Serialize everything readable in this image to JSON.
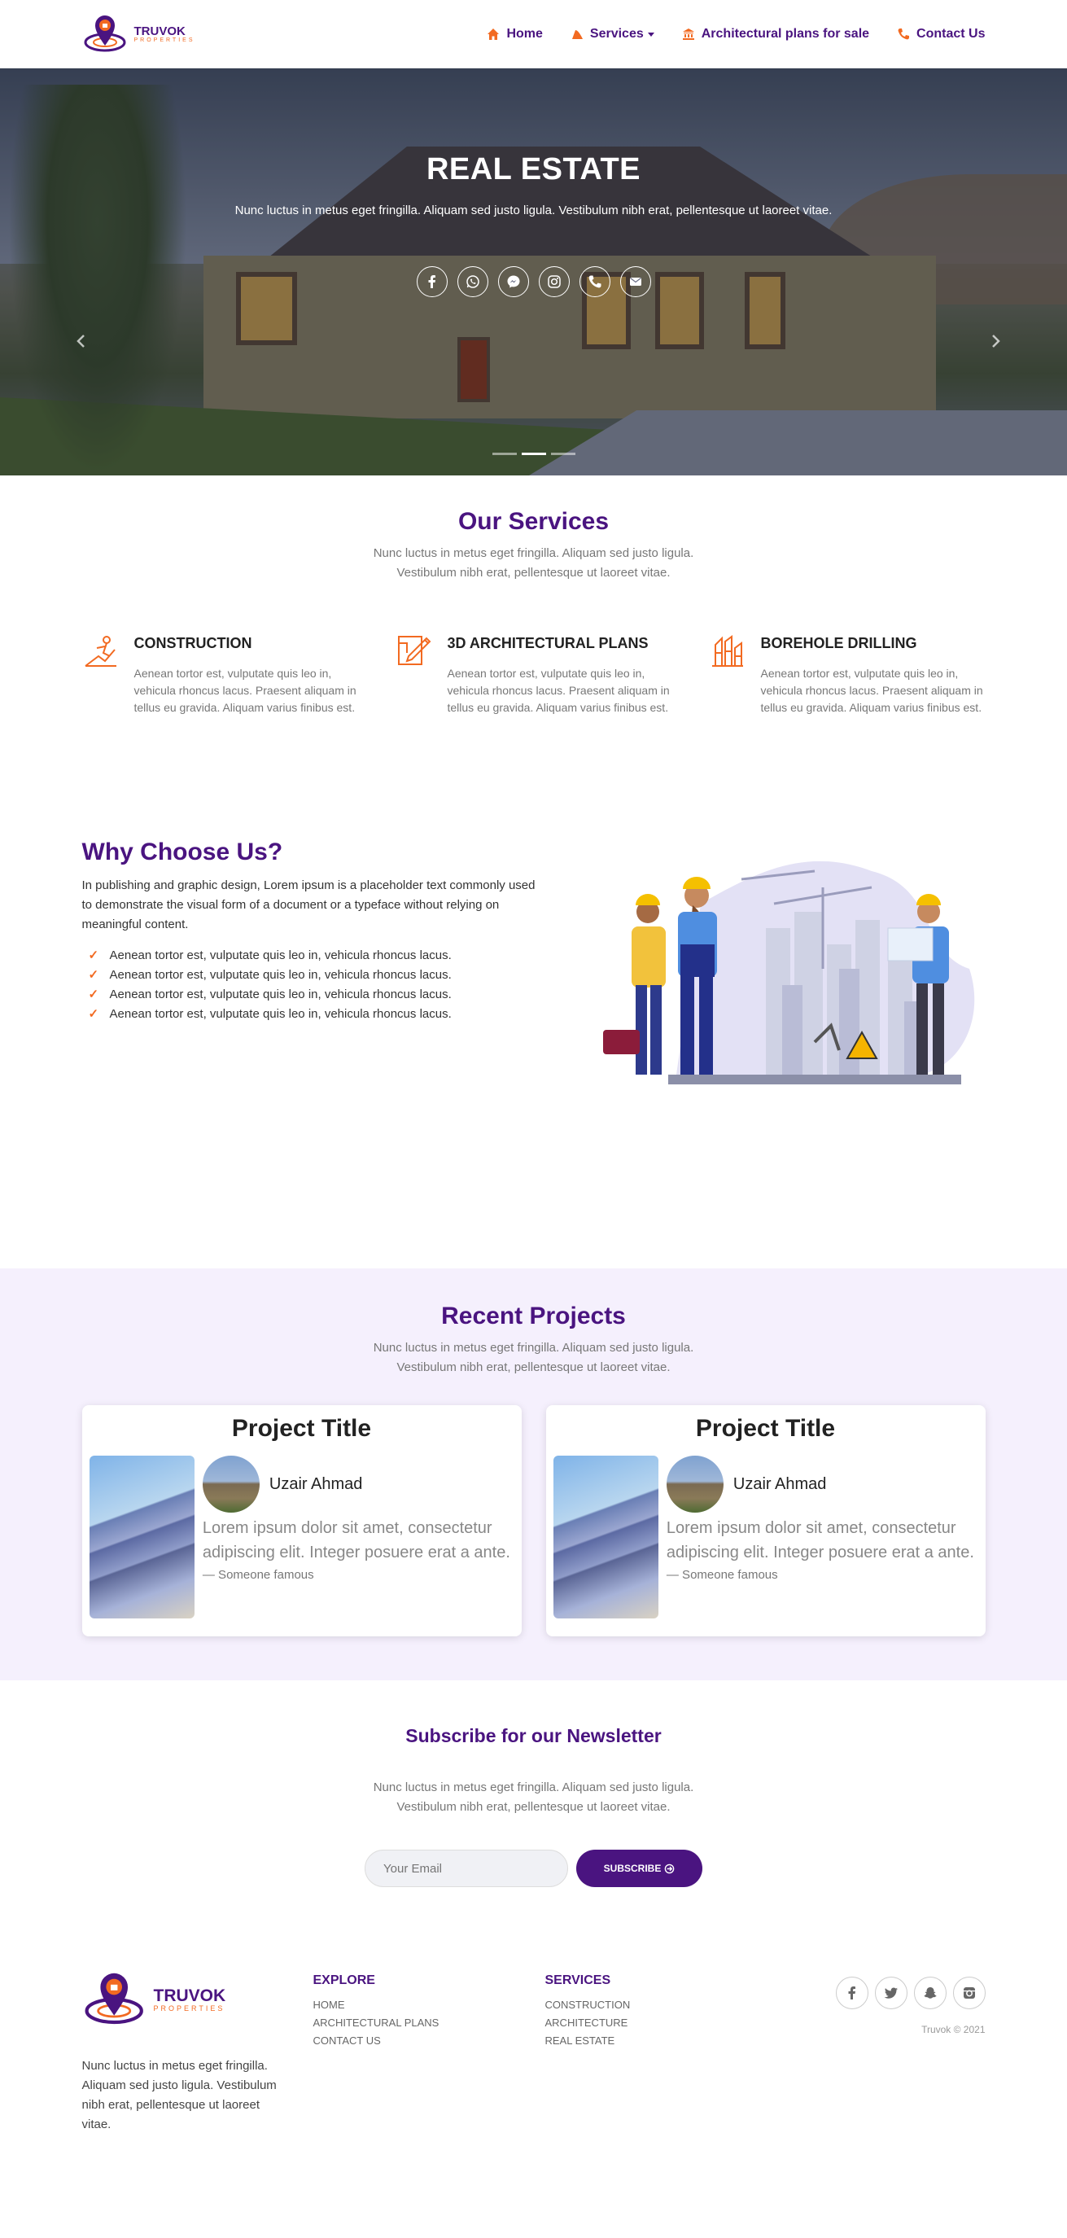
{
  "brand": {
    "name": "TRUVOK",
    "tagline": "PROPERTIES"
  },
  "nav": {
    "items": [
      {
        "label": "Home",
        "icon": "home-icon"
      },
      {
        "label": "Services",
        "icon": "traffic-cone-icon",
        "dropdown": true
      },
      {
        "label": "Architectural plans for sale",
        "icon": "bank-icon"
      },
      {
        "label": "Contact Us",
        "icon": "phone-icon"
      }
    ]
  },
  "hero": {
    "title": "REAL ESTATE",
    "text": "Nunc luctus in metus eget fringilla. Aliquam sed justo ligula. Vestibulum nibh erat, pellentesque ut laoreet vitae.",
    "social_icons": [
      "facebook-icon",
      "whatsapp-icon",
      "messenger-icon",
      "instagram-icon",
      "phone-icon",
      "mail-icon"
    ],
    "slides": 3,
    "active_slide": 2
  },
  "services": {
    "title": "Our Services",
    "subtitle_line1": "Nunc luctus in metus eget fringilla. Aliquam sed justo ligula.",
    "subtitle_line2": "Vestibulum nibh erat, pellentesque ut laoreet vitae.",
    "items": [
      {
        "title": "CONSTRUCTION",
        "text": "Aenean tortor est, vulputate quis leo in, vehicula rhoncus lacus. Praesent aliquam in tellus eu gravida. Aliquam varius finibus est."
      },
      {
        "title": "3D ARCHITECTURAL PLANS",
        "text": "Aenean tortor est, vulputate quis leo in, vehicula rhoncus lacus. Praesent aliquam in tellus eu gravida. Aliquam varius finibus est."
      },
      {
        "title": "BOREHOLE DRILLING",
        "text": "Aenean tortor est, vulputate quis leo in, vehicula rhoncus lacus. Praesent aliquam in tellus eu gravida. Aliquam varius finibus est."
      }
    ]
  },
  "why": {
    "title": "Why Choose Us?",
    "text": "In publishing and graphic design, Lorem ipsum is a placeholder text commonly used to demonstrate the visual form of a document or a typeface without relying on meaningful content.",
    "list": [
      "Aenean tortor est, vulputate quis leo in, vehicula rhoncus lacus.",
      "Aenean tortor est, vulputate quis leo in, vehicula rhoncus lacus.",
      "Aenean tortor est, vulputate quis leo in, vehicula rhoncus lacus.",
      "Aenean tortor est, vulputate quis leo in, vehicula rhoncus lacus."
    ],
    "check": "✓"
  },
  "projects": {
    "title": "Recent Projects",
    "subtitle_line1": "Nunc luctus in metus eget fringilla. Aliquam sed justo ligula.",
    "subtitle_line2": "Vestibulum nibh erat, pellentesque ut laoreet vitae.",
    "cards": [
      {
        "title": "Project Title",
        "author": "Uzair Ahmad",
        "quote": "Lorem ipsum dolor sit amet, consectetur adipiscing elit. Integer posuere erat a ante.",
        "cite": "— Someone famous"
      },
      {
        "title": "Project Title",
        "author": "Uzair Ahmad",
        "quote": "Lorem ipsum dolor sit amet, consectetur adipiscing elit. Integer posuere erat a ante.",
        "cite": "— Someone famous"
      }
    ]
  },
  "newsletter": {
    "title": "Subscribe for our Newsletter",
    "subtitle_line1": "Nunc luctus in metus eget fringilla. Aliquam sed justo ligula.",
    "subtitle_line2": "Vestibulum nibh erat, pellentesque ut laoreet vitae.",
    "placeholder": "Your Email",
    "button": "SUBSCRIBE"
  },
  "footer": {
    "description": "Nunc luctus in metus eget fringilla. Aliquam sed justo ligula. Vestibulum nibh erat, pellentesque ut laoreet vitae.",
    "explore": {
      "title": "EXPLORE",
      "links": [
        "HOME",
        "ARCHITECTURAL PLANS",
        "CONTACT US"
      ]
    },
    "services": {
      "title": "SERVICES",
      "links": [
        "CONSTRUCTION",
        "ARCHITECTURE",
        "REAL ESTATE"
      ]
    },
    "social_icons": [
      "facebook-icon",
      "twitter-icon",
      "snapchat-icon",
      "instagram-icon"
    ],
    "copyright": "Truvok © 2021"
  },
  "colors": {
    "primary": "#4a1480",
    "accent": "#f26a21",
    "projects_bg": "#f5f0fd"
  }
}
